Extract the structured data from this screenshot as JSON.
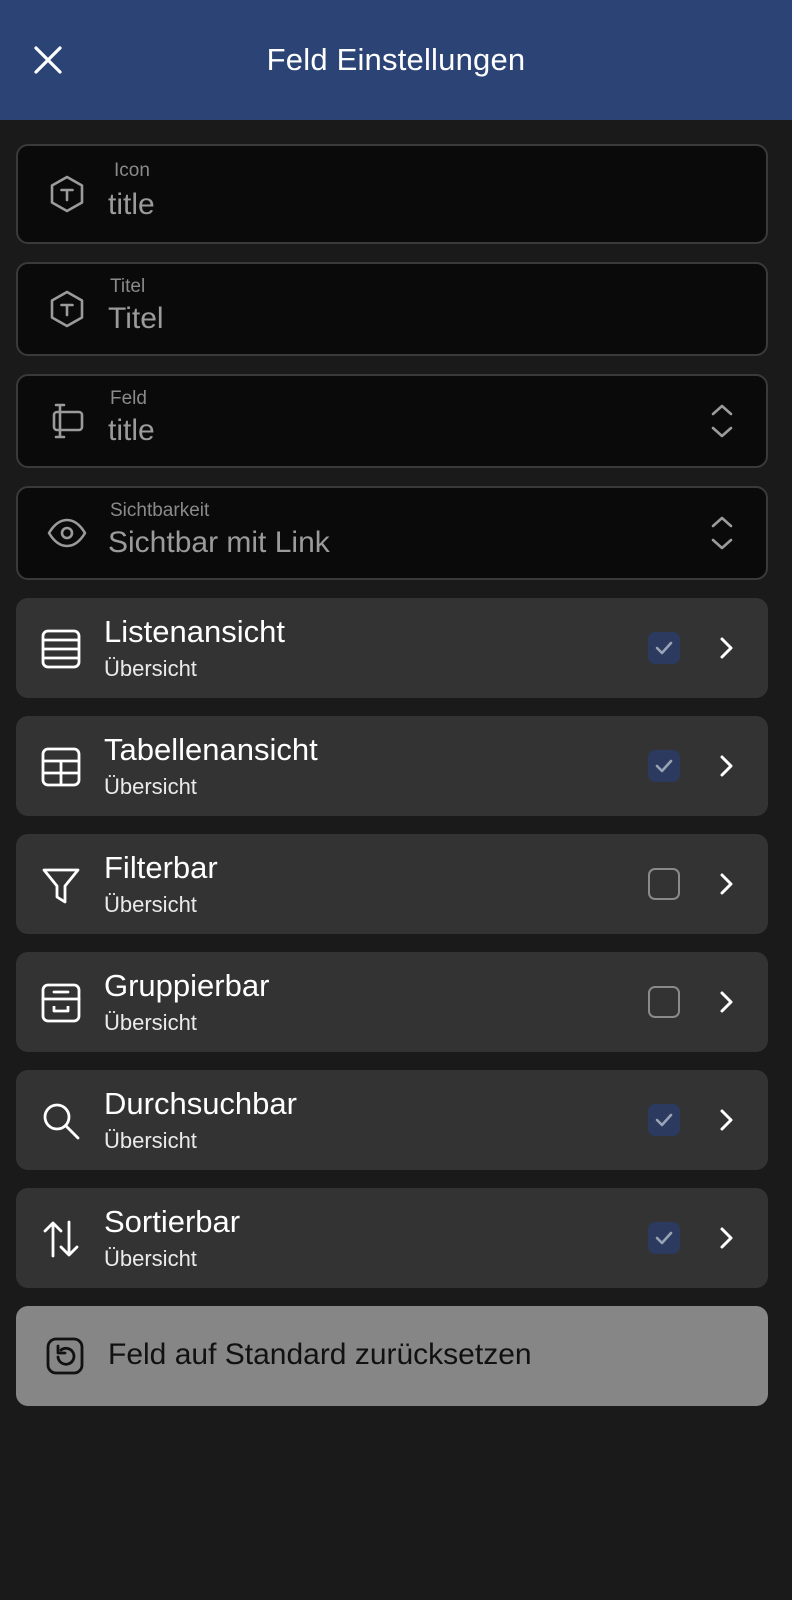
{
  "header": {
    "title": "Feld Einstellungen"
  },
  "fields": [
    {
      "label": "Icon",
      "value": "title",
      "icon": "hexagon-t-icon"
    },
    {
      "label": "Titel",
      "value": "Titel",
      "icon": "hexagon-t-icon"
    },
    {
      "label": "Feld",
      "value": "title",
      "icon": "text-field-icon"
    },
    {
      "label": "Sichtbarkeit",
      "value": "Sichtbar mit Link",
      "icon": "eye-icon"
    }
  ],
  "options": [
    {
      "title": "Listenansicht",
      "subtitle": "Übersicht",
      "checked": true,
      "icon": "list-icon"
    },
    {
      "title": "Tabellenansicht",
      "subtitle": "Übersicht",
      "checked": true,
      "icon": "table-icon"
    },
    {
      "title": "Filterbar",
      "subtitle": "Übersicht",
      "checked": false,
      "icon": "filter-icon"
    },
    {
      "title": "Gruppierbar",
      "subtitle": "Übersicht",
      "checked": false,
      "icon": "archive-icon"
    },
    {
      "title": "Durchsuchbar",
      "subtitle": "Übersicht",
      "checked": true,
      "icon": "search-icon"
    },
    {
      "title": "Sortierbar",
      "subtitle": "Übersicht",
      "checked": true,
      "icon": "sort-icon"
    }
  ],
  "reset": {
    "label": "Feld auf Standard zurücksetzen",
    "icon": "reset-icon"
  },
  "colors": {
    "header": "#2c4475",
    "background": "#1a1a1a",
    "row": "#333333",
    "check_on": "#2b3a5e"
  }
}
